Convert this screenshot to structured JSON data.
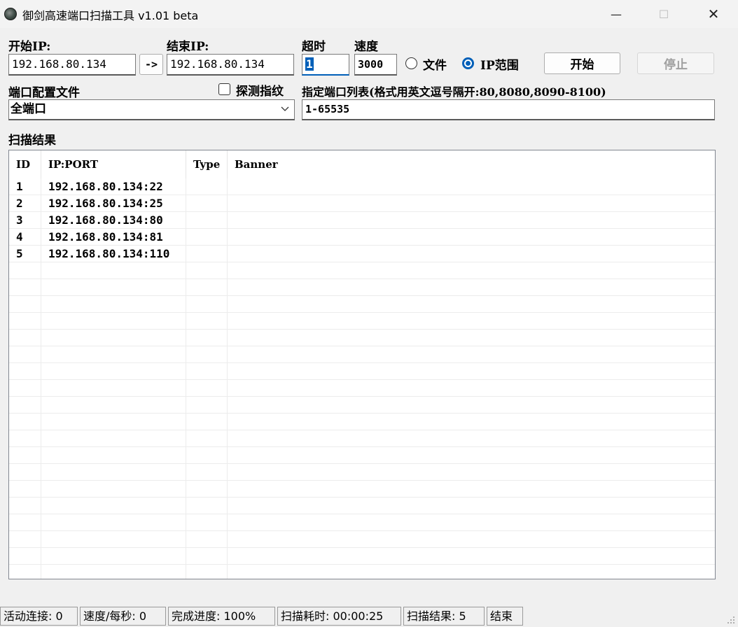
{
  "window": {
    "title": "御剑高速端口扫描工具 v1.01 beta",
    "minimize_glyph": "—",
    "maximize_glyph": "☐",
    "close_glyph": "✕"
  },
  "form": {
    "start_ip_label": "开始IP:",
    "start_ip_value": "192.168.80.134",
    "arrow_label": "->",
    "end_ip_label": "结束IP:",
    "end_ip_value": "192.168.80.134",
    "timeout_label": "超时",
    "timeout_value": "1",
    "speed_label": "速度",
    "speed_value": "3000",
    "radio_file_label": "文件",
    "radio_ip_label": "IP范围",
    "selected_mode": "IP范围",
    "start_button": "开始",
    "stop_button": "停止",
    "port_config_label": "端口配置文件",
    "port_config_value": "全端口",
    "detect_fingerprint_label": "探测指纹",
    "port_list_label": "指定端口列表(格式用英文逗号隔开:80,8080,8090-8100)",
    "port_list_value": "1-65535"
  },
  "results": {
    "section_label": "扫描结果",
    "columns": [
      "ID",
      "IP:PORT",
      "Type",
      "Banner"
    ],
    "rows": [
      {
        "id": "1",
        "ip_port": "192.168.80.134:22",
        "type": "",
        "banner": ""
      },
      {
        "id": "2",
        "ip_port": "192.168.80.134:25",
        "type": "",
        "banner": ""
      },
      {
        "id": "3",
        "ip_port": "192.168.80.134:80",
        "type": "",
        "banner": ""
      },
      {
        "id": "4",
        "ip_port": "192.168.80.134:81",
        "type": "",
        "banner": ""
      },
      {
        "id": "5",
        "ip_port": "192.168.80.134:110",
        "type": "",
        "banner": ""
      }
    ]
  },
  "status": {
    "active_connections": "活动连接: 0",
    "speed_per_sec": "速度/每秒: 0",
    "progress": "完成进度: 100%",
    "elapsed": "扫描耗时: 00:00:25",
    "result_count": "扫描结果: 5",
    "state": "结束"
  },
  "colors": {
    "accent": "#005fb8",
    "window_bg": "#f0f0f0"
  }
}
